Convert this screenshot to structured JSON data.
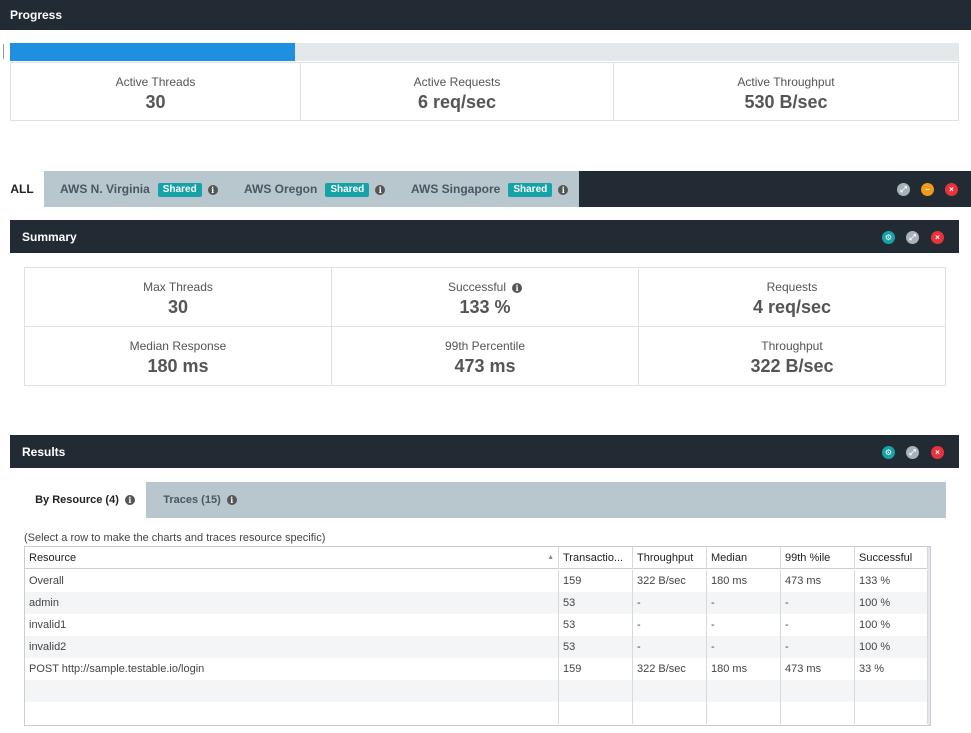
{
  "progress": {
    "title": "Progress",
    "fill_fraction": 0.3,
    "stats": [
      {
        "label": "Active Threads",
        "value": "30"
      },
      {
        "label": "Active Requests",
        "value": "6 req/sec"
      },
      {
        "label": "Active Throughput",
        "value": "530 B/sec"
      }
    ]
  },
  "region_tabs": {
    "all_label": "ALL",
    "regions": [
      {
        "label": "AWS N. Virginia",
        "badge": "Shared"
      },
      {
        "label": "AWS Oregon",
        "badge": "Shared"
      },
      {
        "label": "AWS Singapore",
        "badge": "Shared"
      }
    ]
  },
  "summary": {
    "title": "Summary",
    "stats": [
      {
        "label": "Max Threads",
        "value": "30"
      },
      {
        "label": "Successful",
        "value": "133 %"
      },
      {
        "label": "Requests",
        "value": "4 req/sec"
      },
      {
        "label": "Median Response",
        "value": "180 ms"
      },
      {
        "label": "99th Percentile",
        "value": "473 ms"
      },
      {
        "label": "Throughput",
        "value": "322 B/sec"
      }
    ]
  },
  "results": {
    "title": "Results",
    "tabs": [
      {
        "label": "By Resource (4)"
      },
      {
        "label": "Traces (15)"
      }
    ],
    "hint": "(Select a row to make the charts and traces resource specific)",
    "columns": [
      "Resource",
      "Transactio...",
      "Throughput",
      "Median",
      "99th %ile",
      "Successful"
    ],
    "rows": [
      [
        "Overall",
        "159",
        "322 B/sec",
        "180 ms",
        "473 ms",
        "133 %"
      ],
      [
        "admin",
        "53",
        "-",
        "-",
        "-",
        "100 %"
      ],
      [
        "invalid1",
        "53",
        "-",
        "-",
        "-",
        "100 %"
      ],
      [
        "invalid2",
        "53",
        "-",
        "-",
        "-",
        "100 %"
      ],
      [
        "POST http://sample.testable.io/login",
        "159",
        "322 B/sec",
        "180 ms",
        "473 ms",
        "33 %"
      ]
    ]
  },
  "colors": {
    "dark_bar": "#222a33",
    "progress_fill": "#1f8fe0",
    "badge": "#16a3a8",
    "close": "#e7343c",
    "minimize": "#f19a1c"
  },
  "icons": {
    "info": "info-icon",
    "expand": "expand-icon",
    "minimize": "minimize-icon",
    "close": "close-icon",
    "settings": "settings-icon",
    "sort": "sort-up-icon"
  }
}
